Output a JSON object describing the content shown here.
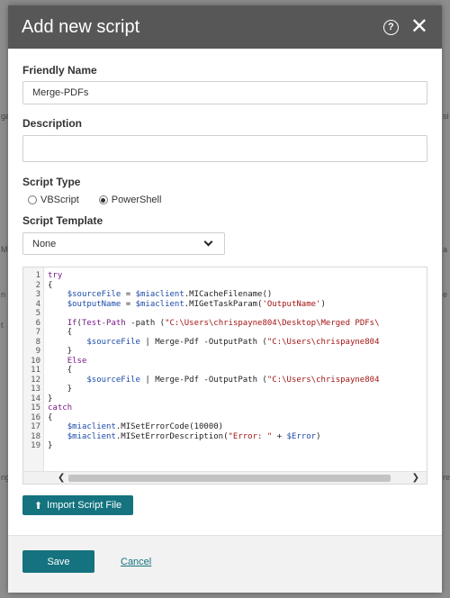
{
  "dialog": {
    "title": "Add new script",
    "help_icon": "question-circle-icon",
    "close_icon": "close-icon"
  },
  "background_fragments": [
    "ga",
    "M",
    "n",
    "t",
    "ng",
    "si",
    "a",
    "e",
    "re"
  ],
  "form": {
    "friendly_name_label": "Friendly Name",
    "friendly_name_value": "Merge-PDFs",
    "description_label": "Description",
    "description_value": "",
    "script_type_label": "Script Type",
    "script_types": [
      "VBScript",
      "PowerShell"
    ],
    "selected_script_type": "PowerShell",
    "script_template_label": "Script Template",
    "script_template_value": "None"
  },
  "editor": {
    "line_numbers": [
      "1",
      "2",
      "3",
      "4",
      "5",
      "6",
      "7",
      "8",
      "9",
      "10",
      "11",
      "12",
      "13",
      "14",
      "15",
      "16",
      "17",
      "18",
      "19"
    ],
    "lines": [
      "try",
      "{",
      "    $sourceFile = $miaclient.MICacheFilename()",
      "    $outputName = $miaclient.MIGetTaskParam('OutputName')",
      "",
      "    If(Test-Path -path (\"C:\\Users\\chrispayne804\\Desktop\\Merged PDFs\\",
      "    {",
      "        $sourceFile | Merge-Pdf -OutputPath (\"C:\\Users\\chrispayne804",
      "    }",
      "    Else",
      "    {",
      "        $sourceFile | Merge-Pdf -OutputPath (\"C:\\Users\\chrispayne804",
      "    }",
      "}",
      "catch",
      "{",
      "    $miaclient.MISetErrorCode(10000)",
      "    $miaclient.MISetErrorDescription(\"Error: \" + $Error)",
      "}"
    ]
  },
  "buttons": {
    "import_label": "Import Script File",
    "import_icon": "upload-icon",
    "save_label": "Save",
    "cancel_label": "Cancel"
  }
}
